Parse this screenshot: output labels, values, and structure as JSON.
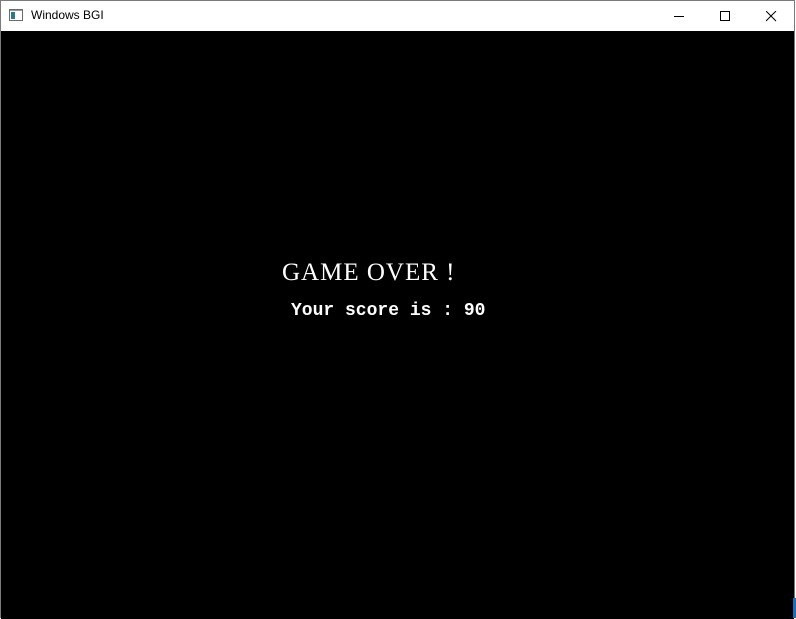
{
  "window": {
    "title": "Windows BGI",
    "app_icon": "bgi-app-icon",
    "controls": {
      "minimize_icon": "minimize-icon",
      "maximize_icon": "maximize-icon",
      "close_icon": "close-icon"
    }
  },
  "canvas": {
    "background": "#000000",
    "text_color": "#ffffff",
    "game_over_text": "GAME OVER !",
    "score_text": "Your score is : 90"
  },
  "colors": {
    "taskbar_edge": "#1e6fb8"
  }
}
